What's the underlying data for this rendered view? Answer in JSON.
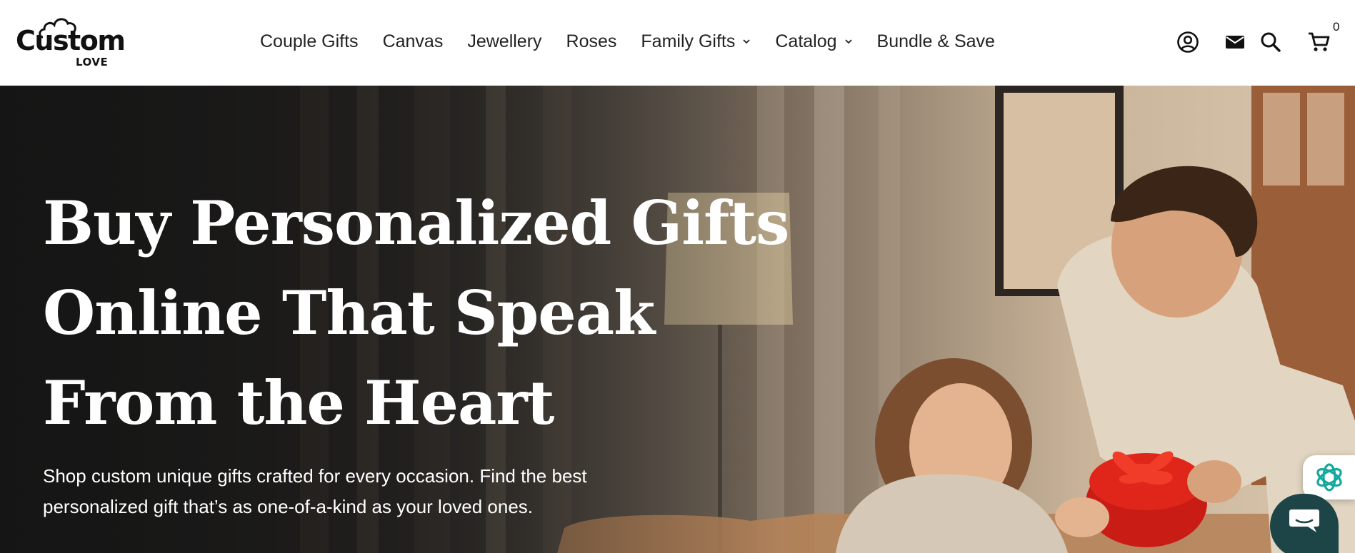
{
  "brand": {
    "logo_main": "Custom",
    "logo_sub": "LOVE"
  },
  "nav": {
    "items": [
      {
        "label": "Couple Gifts",
        "dropdown": false
      },
      {
        "label": "Canvas",
        "dropdown": false
      },
      {
        "label": "Jewellery",
        "dropdown": false
      },
      {
        "label": "Roses",
        "dropdown": false
      },
      {
        "label": "Family Gifts",
        "dropdown": true
      },
      {
        "label": "Catalog",
        "dropdown": true
      },
      {
        "label": "Bundle & Save",
        "dropdown": false
      }
    ]
  },
  "header_icons": {
    "account": "account-icon",
    "mail": "mail-icon",
    "search": "search-icon",
    "cart": "cart-icon",
    "cart_count": "0"
  },
  "hero": {
    "title_lines": [
      "Buy Personalized Gifts",
      "Online That Speak",
      "From the Heart"
    ],
    "subtitle_lines": [
      "Shop custom unique gifts crafted for every occasion. Find the best",
      "personalized gift that’s as one-of-a-kind as your loved ones."
    ]
  },
  "widgets": {
    "ai_assistant": "ai-assistant-icon",
    "chat": "chat-icon"
  },
  "colors": {
    "chat_widget": "#1d4548",
    "ai_icon": "#13a89e",
    "text_dark": "#222222",
    "hero_text": "#ffffff"
  }
}
